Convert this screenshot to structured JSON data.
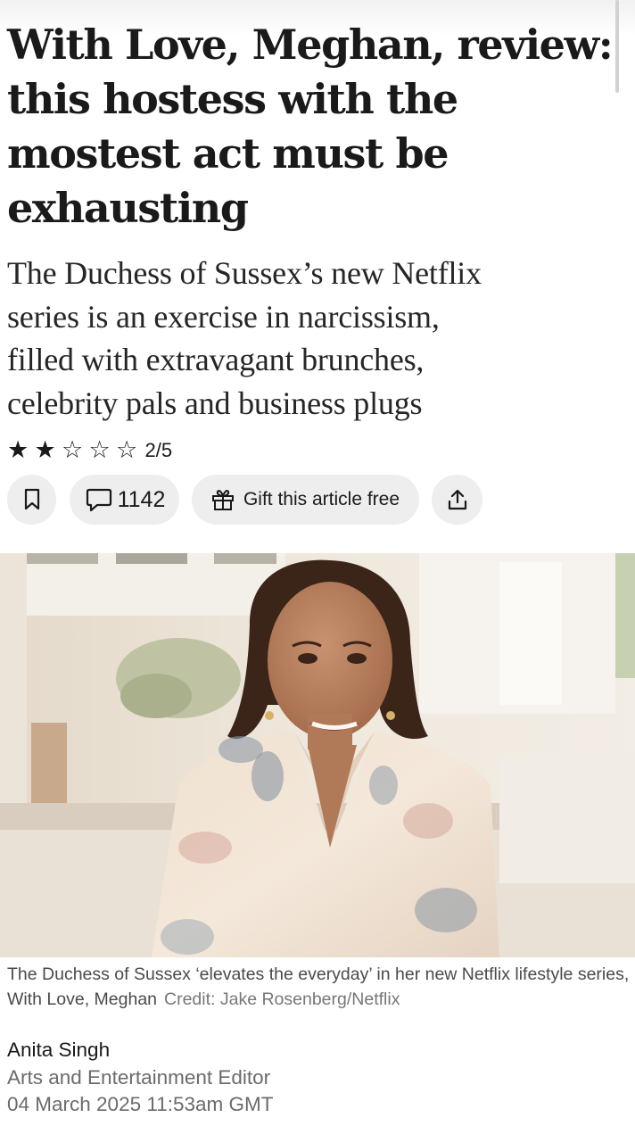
{
  "article": {
    "headline_lines": [
      "With Love, Meghan, review:",
      "this hostess with the",
      "mostest act must be",
      "exhausting"
    ],
    "standfirst_lines": [
      "The Duchess of Sussex’s new Netflix",
      "series is an exercise in narcissism,",
      "filled with extravagant brunches,",
      "celebrity pals and business plugs"
    ],
    "rating": {
      "value": 2,
      "max": 5,
      "filled_star": "★",
      "empty_star": "☆",
      "label": "2/5"
    }
  },
  "actions": {
    "bookmark_icon": "bookmark-icon",
    "comment_icon": "speech-bubble-icon",
    "comment_count": "1142",
    "gift_icon": "gift-icon",
    "gift_label": "Gift this article free",
    "share_icon": "share-icon"
  },
  "image": {
    "caption": "The Duchess of Sussex ‘elevates the everyday’ in her new Netflix lifestyle series, With Love, Meghan",
    "credit": "Credit: Jake Rosenberg/Netflix"
  },
  "byline": {
    "author": "Anita Singh",
    "role": "Arts and Entertainment Editor",
    "date": "04 March 2025 11:53am GMT"
  },
  "colors": {
    "text": "#1a1a1a",
    "muted": "#6b6b6b",
    "pill_background": "#eeeeee"
  }
}
